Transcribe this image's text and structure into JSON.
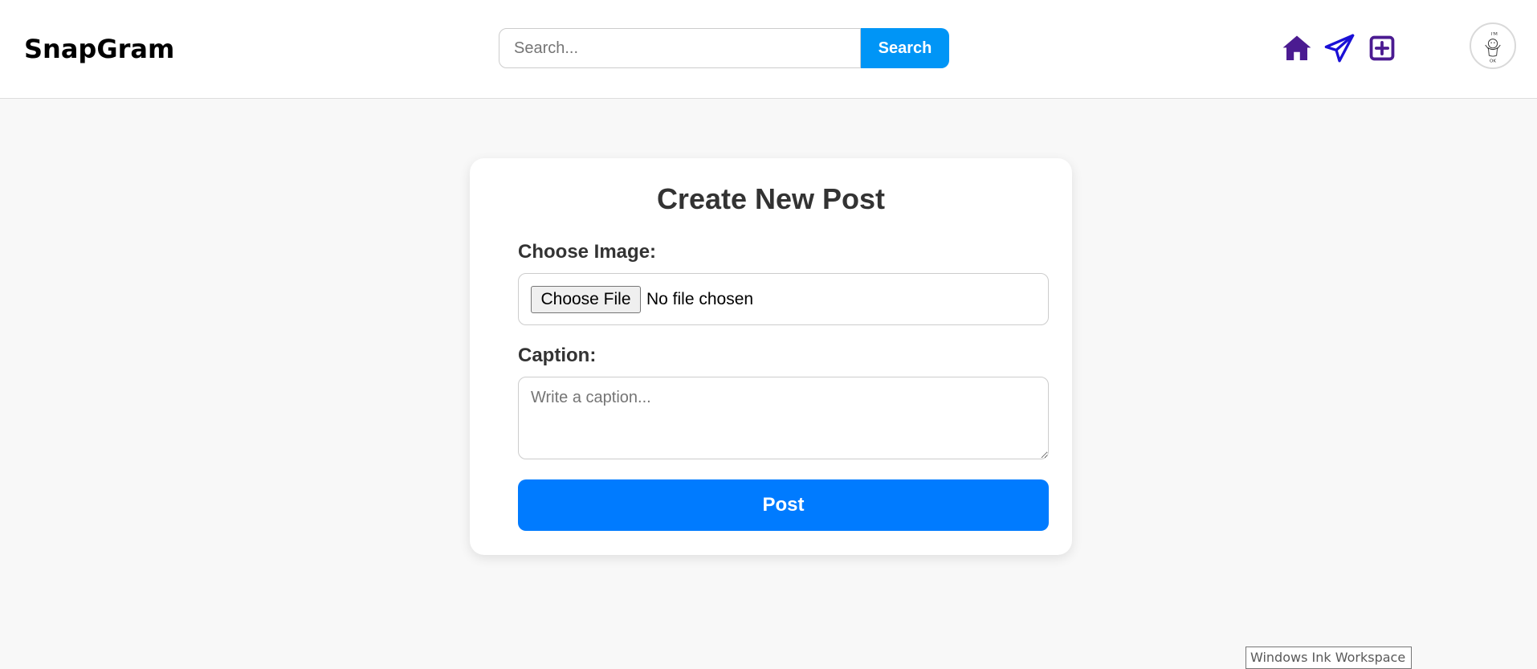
{
  "header": {
    "logo": "SnapGram",
    "search": {
      "placeholder": "Search...",
      "value": "",
      "button_label": "Search"
    },
    "nav_icons": [
      {
        "name": "home-icon",
        "color": "#4b1b91"
      },
      {
        "name": "send-icon",
        "color": "#1a10d6"
      },
      {
        "name": "add-post-icon",
        "color": "#4b1b91"
      }
    ],
    "avatar": {
      "icon": "avatar-doodle-icon",
      "text_top": "I'M",
      "text_bottom": "OK"
    }
  },
  "create_post": {
    "title": "Create New Post",
    "image_label": "Choose Image:",
    "file_button_label": "Choose File",
    "file_status": "No file chosen",
    "caption_label": "Caption:",
    "caption_placeholder": "Write a caption...",
    "caption_value": "",
    "post_button_label": "Post"
  },
  "tooltip": {
    "text": "Windows Ink Workspace"
  },
  "colors": {
    "search_button": "#0095f6",
    "post_button": "#007bff",
    "page_background": "#f8f8f8"
  }
}
